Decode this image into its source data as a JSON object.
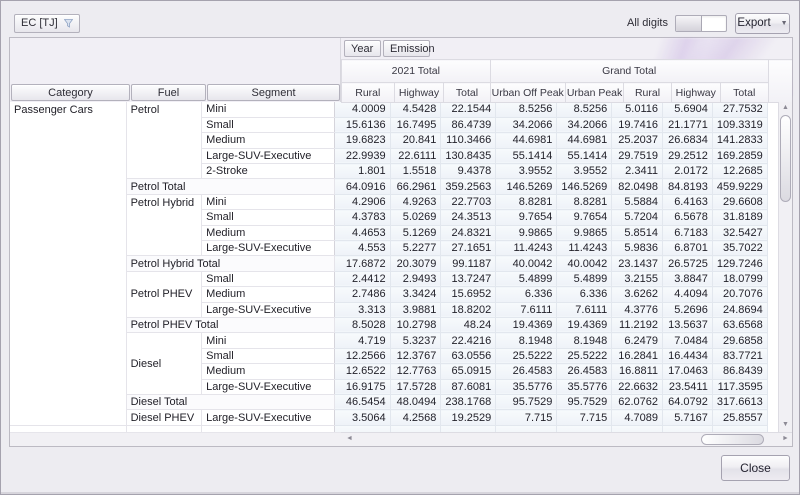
{
  "window": {
    "close_label": "Close"
  },
  "toolbar": {
    "data_field_label": "EC [TJ]",
    "all_digits_label": "All digits",
    "export_label": "Export"
  },
  "fields": {
    "column_fields": [
      "Year",
      "Emission"
    ],
    "row_fields": [
      "Category",
      "Fuel",
      "Segment"
    ]
  },
  "table": {
    "category": "Passenger Cars",
    "column_groups": [
      {
        "label": "2021 Total",
        "columns": [
          "Rural",
          "Highway",
          "Total"
        ]
      },
      {
        "label": "Grand Total",
        "columns": [
          "Urban Off Peak",
          "Urban Peak",
          "Rural",
          "Highway",
          "Total"
        ]
      }
    ],
    "rows": [
      {
        "fuel": "Petrol",
        "fuel_rowspan": 5,
        "fuel_align": "top",
        "segment": "Mini",
        "values": [
          "4.0009",
          "4.5428",
          "22.1544",
          "8.5256",
          "8.5256",
          "5.0116",
          "5.6904",
          "27.7532"
        ]
      },
      {
        "segment": "Small",
        "values": [
          "15.6136",
          "16.7495",
          "86.4739",
          "34.2066",
          "34.2066",
          "19.7416",
          "21.1771",
          "109.3319"
        ]
      },
      {
        "segment": "Medium",
        "values": [
          "19.6823",
          "20.841",
          "110.3466",
          "44.6981",
          "44.6981",
          "25.2037",
          "26.6834",
          "141.2833"
        ]
      },
      {
        "segment": "Large-SUV-Executive",
        "values": [
          "22.9939",
          "22.6111",
          "130.8435",
          "55.1414",
          "55.1414",
          "29.7519",
          "29.2512",
          "169.2859"
        ]
      },
      {
        "segment": "2-Stroke",
        "values": [
          "1.801",
          "1.5518",
          "9.4378",
          "3.9552",
          "3.9552",
          "2.3411",
          "2.0172",
          "12.2685"
        ]
      },
      {
        "total": "Petrol Total",
        "values": [
          "64.0916",
          "66.2961",
          "359.2563",
          "146.5269",
          "146.5269",
          "82.0498",
          "84.8193",
          "459.9229"
        ]
      },
      {
        "fuel": "Petrol Hybrid",
        "fuel_rowspan": 4,
        "fuel_align": "top",
        "segment": "Mini",
        "values": [
          "4.2906",
          "4.9263",
          "22.7703",
          "8.8281",
          "8.8281",
          "5.5884",
          "6.4163",
          "29.6608"
        ]
      },
      {
        "segment": "Small",
        "values": [
          "4.3783",
          "5.0269",
          "24.3513",
          "9.7654",
          "9.7654",
          "5.7204",
          "6.5678",
          "31.8189"
        ]
      },
      {
        "segment": "Medium",
        "values": [
          "4.4653",
          "5.1269",
          "24.8321",
          "9.9865",
          "9.9865",
          "5.8514",
          "6.7183",
          "32.5427"
        ]
      },
      {
        "segment": "Large-SUV-Executive",
        "values": [
          "4.553",
          "5.2277",
          "27.1651",
          "11.4243",
          "11.4243",
          "5.9836",
          "6.8701",
          "35.7022"
        ]
      },
      {
        "total": "Petrol Hybrid Total",
        "values": [
          "17.6872",
          "20.3079",
          "99.1187",
          "40.0042",
          "40.0042",
          "23.1437",
          "26.5725",
          "129.7246"
        ]
      },
      {
        "fuel": "Petrol PHEV",
        "fuel_rowspan": 3,
        "fuel_align": "middle",
        "segment": "Small",
        "values": [
          "2.4412",
          "2.9493",
          "13.7247",
          "5.4899",
          "5.4899",
          "3.2155",
          "3.8847",
          "18.0799"
        ]
      },
      {
        "segment": "Medium",
        "values": [
          "2.7486",
          "3.3424",
          "15.6952",
          "6.336",
          "6.336",
          "3.6262",
          "4.4094",
          "20.7076"
        ]
      },
      {
        "segment": "Large-SUV-Executive",
        "values": [
          "3.313",
          "3.9881",
          "18.8202",
          "7.6111",
          "7.6111",
          "4.3776",
          "5.2696",
          "24.8694"
        ]
      },
      {
        "total": "Petrol PHEV Total",
        "values": [
          "8.5028",
          "10.2798",
          "48.24",
          "19.4369",
          "19.4369",
          "11.2192",
          "13.5637",
          "63.6568"
        ]
      },
      {
        "fuel": "Diesel",
        "fuel_rowspan": 4,
        "fuel_align": "middle",
        "segment": "Mini",
        "values": [
          "4.719",
          "5.3237",
          "22.4216",
          "8.1948",
          "8.1948",
          "6.2479",
          "7.0484",
          "29.6858"
        ]
      },
      {
        "segment": "Small",
        "values": [
          "12.2566",
          "12.3767",
          "63.0556",
          "25.5222",
          "25.5222",
          "16.2841",
          "16.4434",
          "83.7721"
        ]
      },
      {
        "segment": "Medium",
        "values": [
          "12.6522",
          "12.7763",
          "65.0915",
          "26.4583",
          "26.4583",
          "16.8811",
          "17.0463",
          "86.8439"
        ]
      },
      {
        "segment": "Large-SUV-Executive",
        "values": [
          "16.9175",
          "17.5728",
          "87.6081",
          "35.5776",
          "35.5776",
          "22.6632",
          "23.5411",
          "117.3595"
        ]
      },
      {
        "total": "Diesel Total",
        "values": [
          "46.5454",
          "48.0494",
          "238.1768",
          "95.7529",
          "95.7529",
          "62.0762",
          "64.0792",
          "317.6613"
        ]
      },
      {
        "fuel": "Diesel PHEV",
        "fuel_rowspan": 1,
        "fuel_align": "top",
        "segment": "Large-SUV-Executive",
        "values": [
          "3.5064",
          "4.2568",
          "19.2529",
          "7.715",
          "7.715",
          "4.7089",
          "5.7167",
          "25.8557"
        ]
      }
    ]
  },
  "colors": {
    "accent_purple": "#b292d7",
    "cell_blue": "#eef2f8",
    "window_bg": "#edecf1"
  }
}
